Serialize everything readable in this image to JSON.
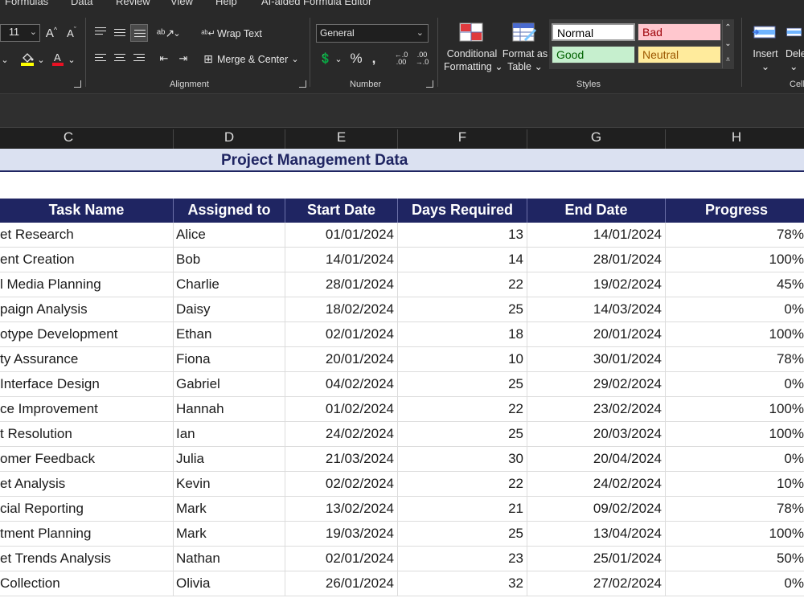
{
  "ribbon": {
    "tabs": [
      "Formulas",
      "Data",
      "Review",
      "View",
      "Help",
      "AI-aided Formula Editor"
    ],
    "font_size": "11",
    "wrap_text": "Wrap Text",
    "merge_center": "Merge & Center",
    "number_format": "General",
    "conditional_formatting": [
      "Conditional",
      "Formatting"
    ],
    "format_as_table": [
      "Format as",
      "Table"
    ],
    "insert": "Insert",
    "delete": "Dele",
    "cells_group": "Cell",
    "groups": {
      "alignment": "Alignment",
      "number": "Number",
      "styles": "Styles"
    },
    "styles": [
      {
        "label": "Normal",
        "bg": "#ffffff",
        "fg": "#000000"
      },
      {
        "label": "Bad",
        "bg": "#ffc7ce",
        "fg": "#9c0006"
      },
      {
        "label": "Good",
        "bg": "#c6efce",
        "fg": "#006100"
      },
      {
        "label": "Neutral",
        "bg": "#ffeb9c",
        "fg": "#9c5700"
      }
    ]
  },
  "columns": [
    "C",
    "D",
    "E",
    "F",
    "G",
    "H"
  ],
  "sheet": {
    "title": "Project Management Data",
    "headers": [
      "Task Name",
      "Assigned to",
      "Start Date",
      "Days Required",
      "End Date",
      "Progress"
    ],
    "rows": [
      [
        "et Research",
        "Alice",
        "01/01/2024",
        "13",
        "14/01/2024",
        "78%"
      ],
      [
        "ent Creation",
        "Bob",
        "14/01/2024",
        "14",
        "28/01/2024",
        "100%"
      ],
      [
        "l Media Planning",
        "Charlie",
        "28/01/2024",
        "22",
        "19/02/2024",
        "45%"
      ],
      [
        "paign Analysis",
        "Daisy",
        "18/02/2024",
        "25",
        "14/03/2024",
        "0%"
      ],
      [
        "otype Development",
        "Ethan",
        "02/01/2024",
        "18",
        "20/01/2024",
        "100%"
      ],
      [
        "ty Assurance",
        "Fiona",
        "20/01/2024",
        "10",
        "30/01/2024",
        "78%"
      ],
      [
        " Interface Design",
        "Gabriel",
        "04/02/2024",
        "25",
        "29/02/2024",
        "0%"
      ],
      [
        "ce Improvement",
        "Hannah",
        "01/02/2024",
        "22",
        "23/02/2024",
        "100%"
      ],
      [
        "t Resolution",
        "Ian",
        "24/02/2024",
        "25",
        "20/03/2024",
        "100%"
      ],
      [
        "omer Feedback",
        "Julia",
        "21/03/2024",
        "30",
        "20/04/2024",
        "0%"
      ],
      [
        "et Analysis",
        "Kevin",
        "02/02/2024",
        "22",
        "24/02/2024",
        "10%"
      ],
      [
        "cial Reporting",
        "Mark",
        "13/02/2024",
        "21",
        "09/02/2024",
        "78%"
      ],
      [
        "tment Planning",
        "Mark",
        "19/03/2024",
        "25",
        "13/04/2024",
        "100%"
      ],
      [
        "et Trends Analysis",
        "Nathan",
        "02/01/2024",
        "23",
        "25/01/2024",
        "50%"
      ],
      [
        " Collection",
        "Olivia",
        "26/01/2024",
        "32",
        "27/02/2024",
        "0%"
      ]
    ]
  }
}
